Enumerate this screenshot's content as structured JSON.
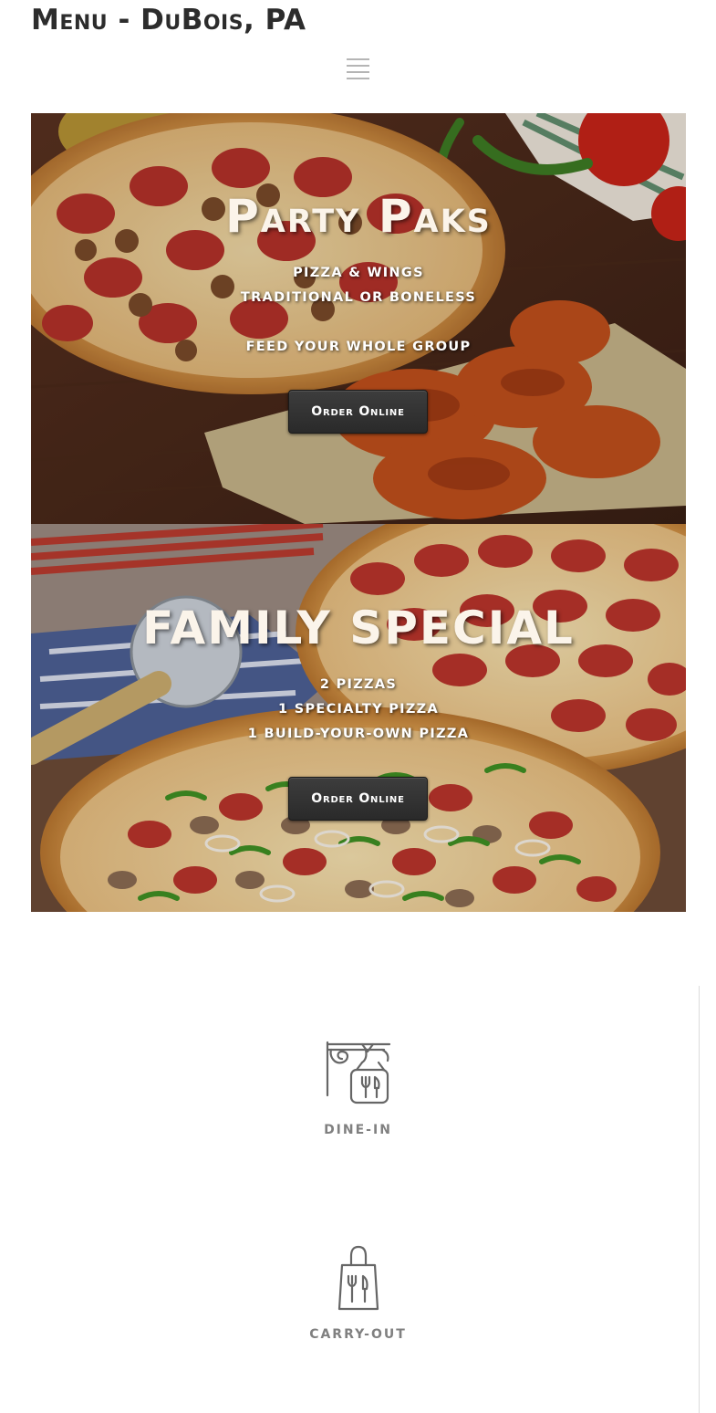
{
  "header": {
    "title": "Menu - DuBois, PA",
    "menu_icon": "hamburger-menu-icon"
  },
  "promos": [
    {
      "title": "Party Paks",
      "lines": [
        "PIZZA & WINGS",
        "TRADITIONAL OR BONELESS",
        "",
        "FEED YOUR WHOLE GROUP"
      ],
      "button_label": "Order Online"
    },
    {
      "title": "FAMILY SPECIAL",
      "lines": [
        "2 PIZZAS",
        "1 SPECIALTY PIZZA",
        "1 BUILD-YOUR-OWN PIZZA"
      ],
      "button_label": "Order Online"
    }
  ],
  "services": [
    {
      "label": "DINE-IN",
      "icon": "hanging-sign-icon"
    },
    {
      "label": "CARRY-OUT",
      "icon": "carry-out-bag-icon"
    }
  ],
  "colors": {
    "title_text": "#2c2c2c",
    "button_bg": "#333333",
    "service_text": "#808080",
    "icon_stroke": "#666666"
  }
}
